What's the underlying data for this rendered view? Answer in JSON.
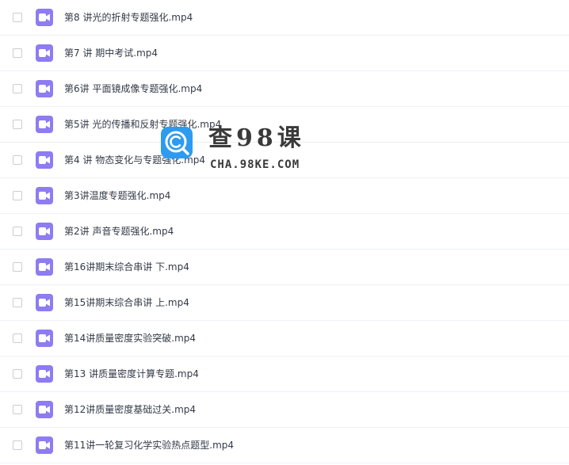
{
  "files": [
    {
      "name": "第8 讲光的折射专题强化.mp4",
      "icon": "video-file-icon"
    },
    {
      "name": "第7 讲 期中考试.mp4",
      "icon": "video-file-icon"
    },
    {
      "name": "第6讲 平面镜成像专题强化.mp4",
      "icon": "video-file-icon"
    },
    {
      "name": "第5讲 光的传播和反射专题强化.mp4",
      "icon": "video-file-icon"
    },
    {
      "name": "第4 讲 物态变化与专题强化.mp4",
      "icon": "video-file-icon"
    },
    {
      "name": "第3讲温度专题强化.mp4",
      "icon": "video-file-icon"
    },
    {
      "name": "第2讲 声音专题强化.mp4",
      "icon": "video-file-icon"
    },
    {
      "name": "第16讲期末综合串讲 下.mp4",
      "icon": "video-file-icon"
    },
    {
      "name": "第15讲期末综合串讲 上.mp4",
      "icon": "video-file-icon"
    },
    {
      "name": "第14讲质量密度实验突破.mp4",
      "icon": "video-file-icon"
    },
    {
      "name": "第13 讲质量密度计算专题.mp4",
      "icon": "video-file-icon"
    },
    {
      "name": "第12讲质量密度基础过关.mp4",
      "icon": "video-file-icon"
    },
    {
      "name": "第11讲一轮复习化学实验热点题型.mp4",
      "icon": "video-file-icon"
    }
  ],
  "watermark": {
    "title": "查98课",
    "domain": "CHA.98KE.COM",
    "logo_icon": "search-c-logo-icon"
  },
  "colors": {
    "icon_bg": "#8d7cf2",
    "text": "#333a47",
    "divider": "#eef0f4",
    "logo_bg": "#2d9bf0"
  }
}
